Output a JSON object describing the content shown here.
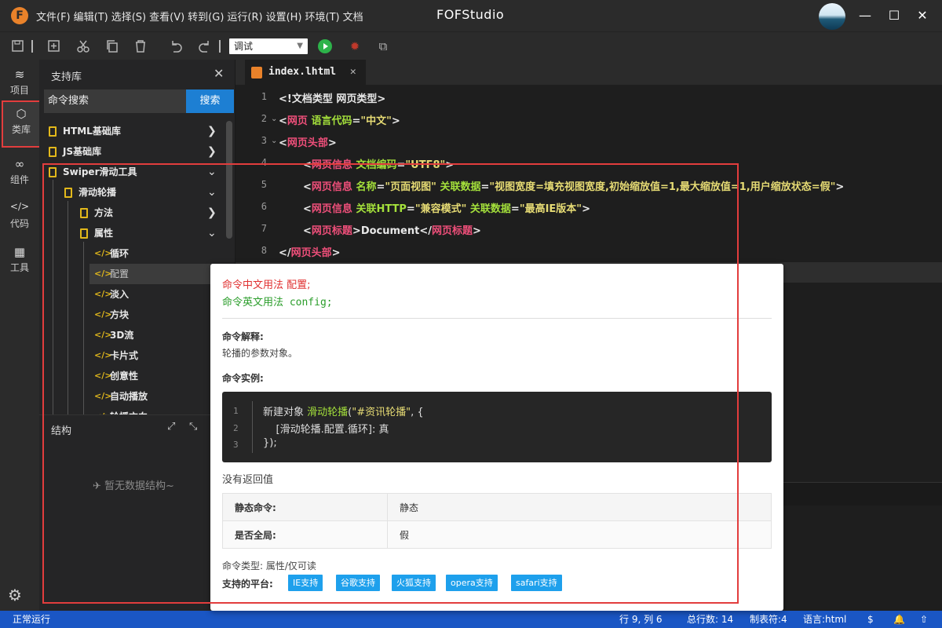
{
  "titlebar": {
    "logo": "F",
    "menu": [
      "文件(F)",
      "编辑(T)",
      "选择(S)",
      "查看(V)",
      "转到(G)",
      "运行(R)",
      "设置(H)",
      "环境(T)",
      "文档"
    ],
    "app_title": "FOFStudio",
    "window_controls": {
      "minimize": "—",
      "maximize": "☐",
      "close": "✕"
    }
  },
  "toolbar": {
    "icons": [
      "save-icon",
      "new-file-icon",
      "cut-icon",
      "copy-icon",
      "delete-icon",
      "undo-icon",
      "redo-icon"
    ],
    "mode_select": "调试",
    "mode_caret": "▼",
    "debug_icon": "✹",
    "preview_icon": "⧉"
  },
  "activity": [
    {
      "label": "项目",
      "icon": "≋"
    },
    {
      "label": "类库",
      "icon": "⬡"
    },
    {
      "label": "组件",
      "icon": "∞"
    },
    {
      "label": "代码",
      "icon": "</>"
    },
    {
      "label": "工具",
      "icon": "▦"
    }
  ],
  "activity_settings_icon": "⚙",
  "sidebar": {
    "header": "支持库",
    "close": "✕",
    "search_placeholder": "命令搜索",
    "search_button": "搜索",
    "tree": [
      {
        "label": "HTML基础库",
        "chevron": "❯"
      },
      {
        "label": "JS基础库",
        "chevron": "❯"
      },
      {
        "label": "Swiper滑动工具",
        "chevron": "⌄"
      },
      {
        "label": "滑动轮播",
        "chevron": "⌄"
      },
      {
        "label": "方法",
        "chevron": "❯"
      },
      {
        "label": "属性",
        "chevron": "⌄"
      }
    ],
    "code_icon": "</>",
    "properties": [
      "循环",
      "配置",
      "淡入",
      "方块",
      "3D流",
      "卡片式",
      "创意性",
      "自动播放",
      "轮播方向"
    ],
    "structure": {
      "title": "结构",
      "expand_icon": "⤢",
      "collapse_icon": "⤡",
      "empty": "✈  暂无数据结构~"
    }
  },
  "editor": {
    "tab_name": "index.lhtml",
    "tab_close": "✕",
    "line_numbers": [
      "1",
      "2",
      "3",
      "4",
      "5",
      "6",
      "7",
      "8"
    ],
    "fold_markers": [
      "⌄",
      "⌄"
    ],
    "lines": {
      "l1": "<!文档类型 网页类型>",
      "l2_tag": "网页",
      "l2_attr": "语言代码",
      "l2_val": "\"中文\"",
      "l3_tag": "网页头部",
      "l4_tag": "网页信息",
      "l4_attr": "文档编码",
      "l4_val": "\"UTF8\"",
      "l5_tag": "网页信息",
      "l5_attr1": "名称",
      "l5_val1": "\"页面视图\"",
      "l5_attr2": "关联数据",
      "l5_val2": "\"视图宽度=填充视图宽度,初始缩放值=1,最大缩放值=1,用户缩放状态=假\"",
      "l6_tag": "网页信息",
      "l6_attr1": "关联HTTP",
      "l6_val1": "\"兼容模式\"",
      "l6_attr2": "关联数据",
      "l6_val2": "\"最高IE版本\"",
      "l7_tag": "网页标题",
      "l7_text": "Document",
      "l8_tag": "网页头部"
    }
  },
  "tooltip": {
    "zh_usage": "命令中文用法  配置;",
    "en_usage": "命令英文用法  config;",
    "explain_title": "命令解释:",
    "explain_text": "轮播的参数对象。",
    "example_title": "命令实例:",
    "example_lines": [
      "1",
      "2",
      "3"
    ],
    "example": {
      "l1_a": "新建对象 ",
      "l1_fn": "滑动轮播",
      "l1_b": "(",
      "l1_str": "\"#资讯轮播\"",
      "l1_c": ", {",
      "l2": "    [滑动轮播.配置.循环]: 真",
      "l3": "});"
    },
    "return_text": "没有返回值",
    "table": [
      {
        "key": "静态命令:",
        "value": "静态"
      },
      {
        "key": "是否全局:",
        "value": "假"
      }
    ],
    "cmd_type": "命令类型: 属性/仅可读",
    "platforms_label": "支持的平台:",
    "platforms": [
      "IE支持",
      "谷歌支持",
      "火狐支持",
      "opera支持",
      "safari支持"
    ]
  },
  "statusbar": {
    "left": "正常运行",
    "position": "行 9, 列 6",
    "total_lines": "总行数: 14",
    "tab_size": "制表符:4",
    "language": "语言:html",
    "icons": [
      "$",
      "🔔",
      "⇧"
    ]
  }
}
